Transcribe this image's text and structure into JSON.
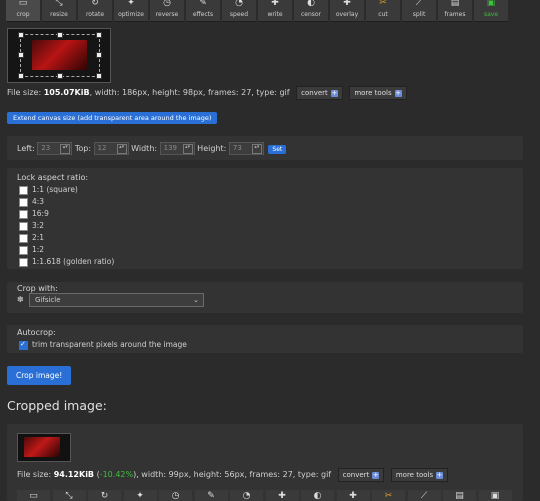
{
  "toolbar": {
    "items": [
      {
        "label": "crop",
        "icon": "crop-icon"
      },
      {
        "label": "resize",
        "icon": "resize-icon"
      },
      {
        "label": "rotate",
        "icon": "rotate-icon"
      },
      {
        "label": "optimize",
        "icon": "optimize-icon"
      },
      {
        "label": "reverse",
        "icon": "reverse-icon"
      },
      {
        "label": "effects",
        "icon": "effects-icon"
      },
      {
        "label": "speed",
        "icon": "speed-icon"
      },
      {
        "label": "write",
        "icon": "write-icon"
      },
      {
        "label": "censor",
        "icon": "censor-icon"
      },
      {
        "label": "overlay",
        "icon": "overlay-icon"
      },
      {
        "label": "cut",
        "icon": "cut-icon"
      },
      {
        "label": "split",
        "icon": "split-icon"
      },
      {
        "label": "frames",
        "icon": "frames-icon"
      },
      {
        "label": "save",
        "icon": "save-icon"
      }
    ]
  },
  "source": {
    "file_size_label": "File size:",
    "file_size": "105.07KiB",
    "details": ", width: 186px, height: 98px, frames: 27, type: gif",
    "convert": "convert",
    "more_tools": "more tools"
  },
  "extend_canvas_label": "Extend canvas size (add transparent area around the image)",
  "dims": {
    "left_label": "Left:",
    "left": "23",
    "top_label": "Top:",
    "top": "12",
    "width_label": "Width:",
    "width": "139",
    "height_label": "Height:",
    "height": "73",
    "set": "Set"
  },
  "aspect": {
    "title": "Lock aspect ratio:",
    "options": [
      "1:1 (square)",
      "4:3",
      "16:9",
      "3:2",
      "2:1",
      "1:2",
      "1:1.618 (golden ratio)"
    ]
  },
  "crop_with": {
    "title": "Crop with:",
    "value": "Gifsicle"
  },
  "autocrop": {
    "title": "Autocrop:",
    "option": "trim transparent pixels around the image"
  },
  "crop_button": "Crop image!",
  "result": {
    "heading": "Cropped image:",
    "file_size_label": "File size:",
    "file_size": "94.12KiB",
    "open_paren": " (",
    "percent": "-10.42%",
    "details": "), width: 99px, height: 56px, frames: 27, type: gif",
    "convert": "convert",
    "more_tools": "more tools"
  },
  "colors": {
    "accent": "#2a6fd6",
    "save_green": "#3fbf3f",
    "percent_green": "#3fbf3f"
  }
}
